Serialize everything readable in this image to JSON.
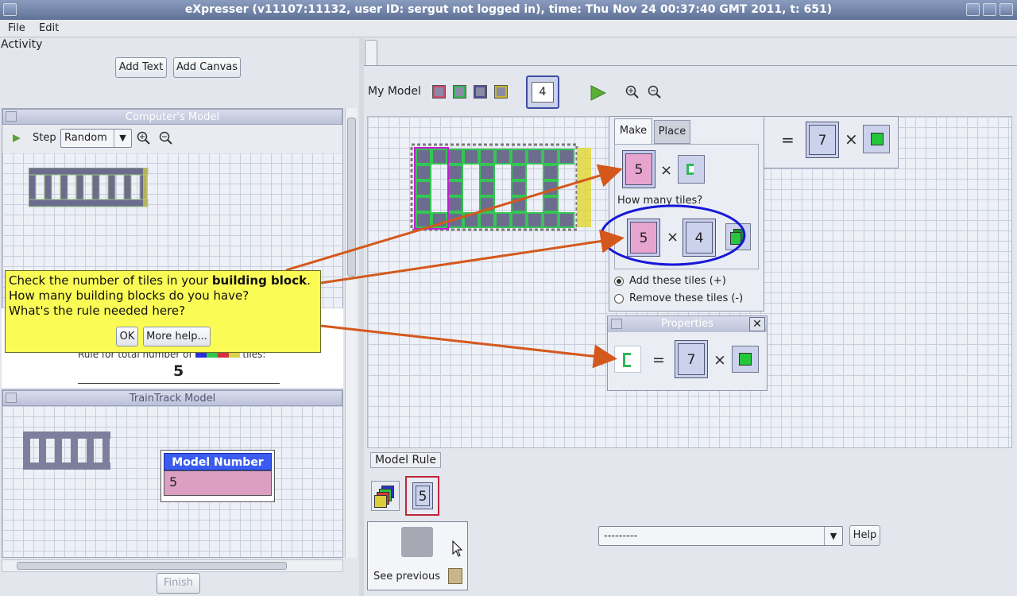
{
  "window": {
    "title": "eXpresser (v11107:11132, user ID: sergut not logged in), time: Thu Nov 24 00:37:40 GMT 2011, t: 651)"
  },
  "menu": {
    "file": "File",
    "edit": "Edit"
  },
  "activity": {
    "label": "Activity",
    "add_text": "Add Text",
    "add_canvas": "Add Canvas"
  },
  "computer_model": {
    "title": "Computer's Model",
    "step_label": "Step",
    "mode_value": "Random",
    "rule_label": "Rule for total number of",
    "rule_suffix": "tiles:",
    "rule_value": "5"
  },
  "traintrack": {
    "title": "TrainTrack Model",
    "model_number_title": "Model Number",
    "model_number_value": "5"
  },
  "finish_label": "Finish",
  "my_model": {
    "label": "My Model",
    "value": "4",
    "colors": [
      "#d0486d",
      "#35b85b",
      "#4d4ea0",
      "#c7b532"
    ]
  },
  "make_place": {
    "tab_make": "Make",
    "tab_place": "Place",
    "top_value": "5",
    "how_many": "How many tiles?",
    "mult_a": "5",
    "mult_b": "4",
    "add_option": "Add these tiles (+)",
    "remove_option": "Remove these tiles (-)"
  },
  "top_rule": {
    "equals": "=",
    "value": "7",
    "times": "×"
  },
  "properties": {
    "title": "Properties",
    "equals": "=",
    "value": "7",
    "times": "×"
  },
  "model_rule": {
    "label": "Model Rule",
    "value": "5"
  },
  "see_previous": "See previous",
  "dropdown_value": "---------",
  "help_label": "Help",
  "callout": {
    "line1_pre": "Check the number of tiles in your ",
    "line1_bold": "building block",
    "line1_post": ".",
    "line2": "How many building blocks do you have?",
    "line3": "What's the rule needed here?",
    "ok": "OK",
    "more_help": "More help..."
  },
  "icons": [
    "java-icon",
    "play-icon",
    "zoom-in-icon",
    "zoom-out-icon",
    "close-icon",
    "tile-stack-icon",
    "cursor-icon"
  ]
}
